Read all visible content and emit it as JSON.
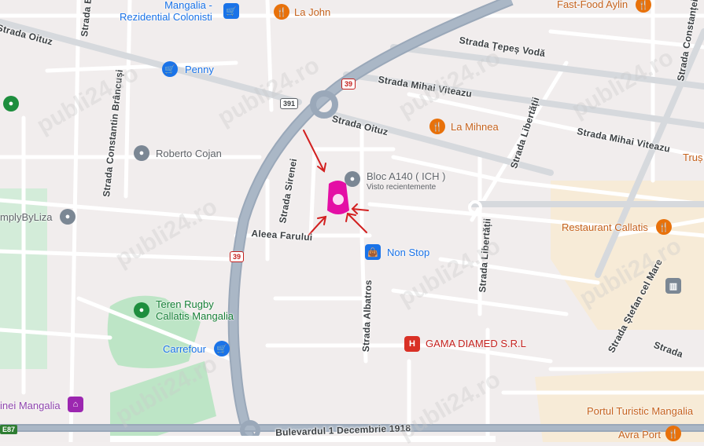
{
  "map": {
    "streets": {
      "oituz_top": "Strada Oituz",
      "tepes": "Strada Țepeș Vodă",
      "mihai1": "Strada Mihai Viteazu",
      "mihai2": "Strada Mihai Viteazu",
      "oituz_mid": "Strada Oituz",
      "constantin": "Strada Constantin Brâncuși",
      "strada_b": "Strada B",
      "sirenei": "Strada Sirenei",
      "farului": "Aleea Farului",
      "albatros": "Strada Albatros",
      "libertatii1": "Strada Libertății",
      "libertatii2": "Strada Libertății",
      "stefan": "Strada Ștefan cel Mare",
      "constantei": "Strada Constanței",
      "strada_right": "Strada",
      "bottom": "Bulevardul 1 Decembrie 1918"
    },
    "roads": {
      "r391": "391",
      "r39a": "39",
      "r39b": "39",
      "e87": "E87"
    },
    "pois": {
      "mangalia": "Mangalia -\nRezidential Colonisti",
      "la_john": "La John",
      "fast_food": "Fast-Food Aylin",
      "penny": "Penny",
      "la_mihnea": "La Mihnea",
      "roberto": "Roberto Cojan",
      "bloc": "Bloc A140 ( ICH )",
      "bloc_sub": "Visto recientemente",
      "simply": "mplyByLiza",
      "non_stop": "Non Stop",
      "restaurant": "Restaurant Callatis",
      "teren": "Teren Rugby\nCallatis Mangalia",
      "carrefour": "Carrefour",
      "gama": "GAMA DIAMED S.R.L",
      "inei": "inei Mangalia",
      "portul": "Portul Turistic Mangalia",
      "avra": "Avra Port",
      "trus": "Truș"
    },
    "watermark": "publi24.ro"
  }
}
